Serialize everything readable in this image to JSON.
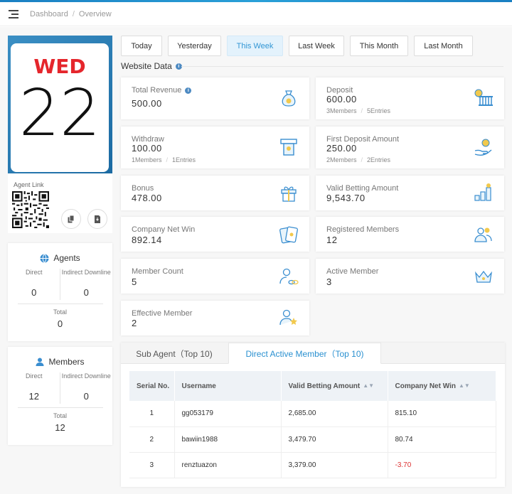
{
  "header": {
    "breadcrumb": [
      "Dashboard",
      "Overview"
    ]
  },
  "calendar": {
    "weekday": "WED",
    "day": "22"
  },
  "agent_link": {
    "label": "Agent Link"
  },
  "agents": {
    "title": "Agents",
    "direct_label": "Direct",
    "direct_value": "0",
    "indirect_label": "Indirect Downline",
    "indirect_value": "0",
    "total_label": "Total",
    "total_value": "0"
  },
  "members": {
    "title": "Members",
    "direct_label": "Direct",
    "direct_value": "12",
    "indirect_label": "Indirect Downline",
    "indirect_value": "0",
    "total_label": "Total",
    "total_value": "12"
  },
  "date_tabs": [
    "Today",
    "Yesterday",
    "This Week",
    "Last Week",
    "This Month",
    "Last Month"
  ],
  "active_date_tab": "This Week",
  "section_title": "Website Data",
  "cards": {
    "total_revenue": {
      "title": "Total Revenue",
      "value": "500.00"
    },
    "deposit": {
      "title": "Deposit",
      "value": "600.00",
      "members": "3Members",
      "entries": "5Entries"
    },
    "withdraw": {
      "title": "Withdraw",
      "value": "100.00",
      "members": "1Members",
      "entries": "1Entries"
    },
    "first_deposit": {
      "title": "First Deposit Amount",
      "value": "250.00",
      "members": "2Members",
      "entries": "2Entries"
    },
    "bonus": {
      "title": "Bonus",
      "value": "478.00"
    },
    "valid_betting": {
      "title": "Valid Betting Amount",
      "value": "9,543.70"
    },
    "company_net_win": {
      "title": "Company Net Win",
      "value": "892.14"
    },
    "registered_members": {
      "title": "Registered Members",
      "value": "12"
    },
    "member_count": {
      "title": "Member Count",
      "value": "5"
    },
    "active_member": {
      "title": "Active Member",
      "value": "3"
    },
    "effective_member": {
      "title": "Effective Member",
      "value": "2"
    }
  },
  "table_tabs": [
    "Sub Agent（Top 10)",
    "Direct Active Member（Top 10)"
  ],
  "table": {
    "headers": [
      "Serial No.",
      "Username",
      "Valid Betting Amount",
      "Company Net Win"
    ],
    "rows": [
      [
        "1",
        "gg053179",
        "2,685.00",
        "815.10"
      ],
      [
        "2",
        "bawiin1988",
        "3,479.70",
        "80.74"
      ],
      [
        "3",
        "renztuazon",
        "3,379.00",
        "-3.70"
      ]
    ]
  },
  "colors": {
    "accent": "#3196d4",
    "weekday": "#e5262c",
    "negative": "#dd3333"
  }
}
